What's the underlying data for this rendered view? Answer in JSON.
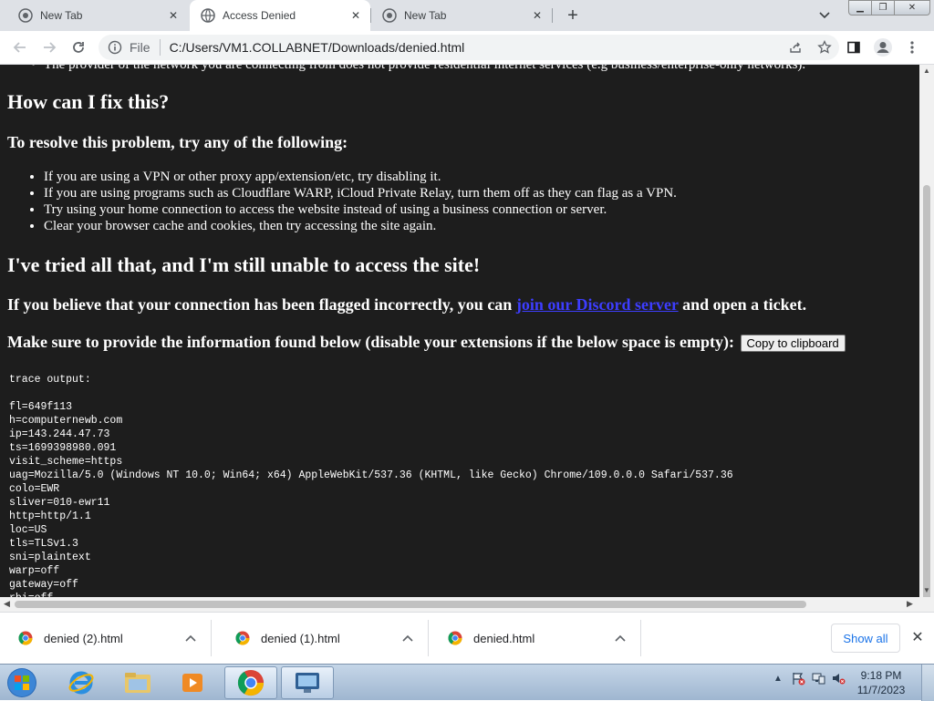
{
  "tabs": [
    {
      "title": "New Tab",
      "active": false
    },
    {
      "title": "Access Denied",
      "active": true
    },
    {
      "title": "New Tab",
      "active": false
    }
  ],
  "toolbar": {
    "file_label": "File",
    "url": "C:/Users/VM1.COLLABNET/Downloads/denied.html"
  },
  "page": {
    "cut_off_line": "The provider of the network you are connecting from does not provide residential internet services (e.g business/enterprise-only networks).",
    "heading_fix": "How can I fix this?",
    "resolve_intro": "To resolve this problem, try any of the following:",
    "fix_items": [
      "If you are using a VPN or other proxy app/extension/etc, try disabling it.",
      "If you are using programs such as Cloudflare WARP, iCloud Private Relay, turn them off as they can flag as a VPN.",
      "Try using your home connection to access the website instead of using a business connection or server.",
      "Clear your browser cache and cookies, then try accessing the site again."
    ],
    "heading_tried": "I've tried all that, and I'm still unable to access the site!",
    "flagged_before": "If you believe that your connection has been flagged incorrectly, you can ",
    "flagged_link": "join our Discord server",
    "flagged_after": " and open a ticket.",
    "provide_info": "Make sure to provide the information found below (disable your extensions if the below space is empty):",
    "copy_button": "Copy to clipboard",
    "trace_output": "trace output:\n\nfl=649f113\nh=computernewb.com\nip=143.244.47.73\nts=1699398980.091\nvisit_scheme=https\nuag=Mozilla/5.0 (Windows NT 10.0; Win64; x64) AppleWebKit/537.36 (KHTML, like Gecko) Chrome/109.0.0.0 Safari/537.36\ncolo=EWR\nsliver=010-ewr11\nhttp=http/1.1\nloc=US\ntls=TLSv1.3\nsni=plaintext\nwarp=off\ngateway=off\nrbi=off"
  },
  "downloads": {
    "items": [
      {
        "name": "denied (2).html"
      },
      {
        "name": "denied (1).html"
      },
      {
        "name": "denied.html"
      }
    ],
    "show_all": "Show all"
  },
  "taskbar": {
    "time": "9:18 PM",
    "date": "11/7/2023"
  },
  "colors": {
    "page_background": "#1d1d1d",
    "link": "#3d3dff",
    "tab_strip": "#dee1e6",
    "taskbar": "#b4c8dd"
  }
}
